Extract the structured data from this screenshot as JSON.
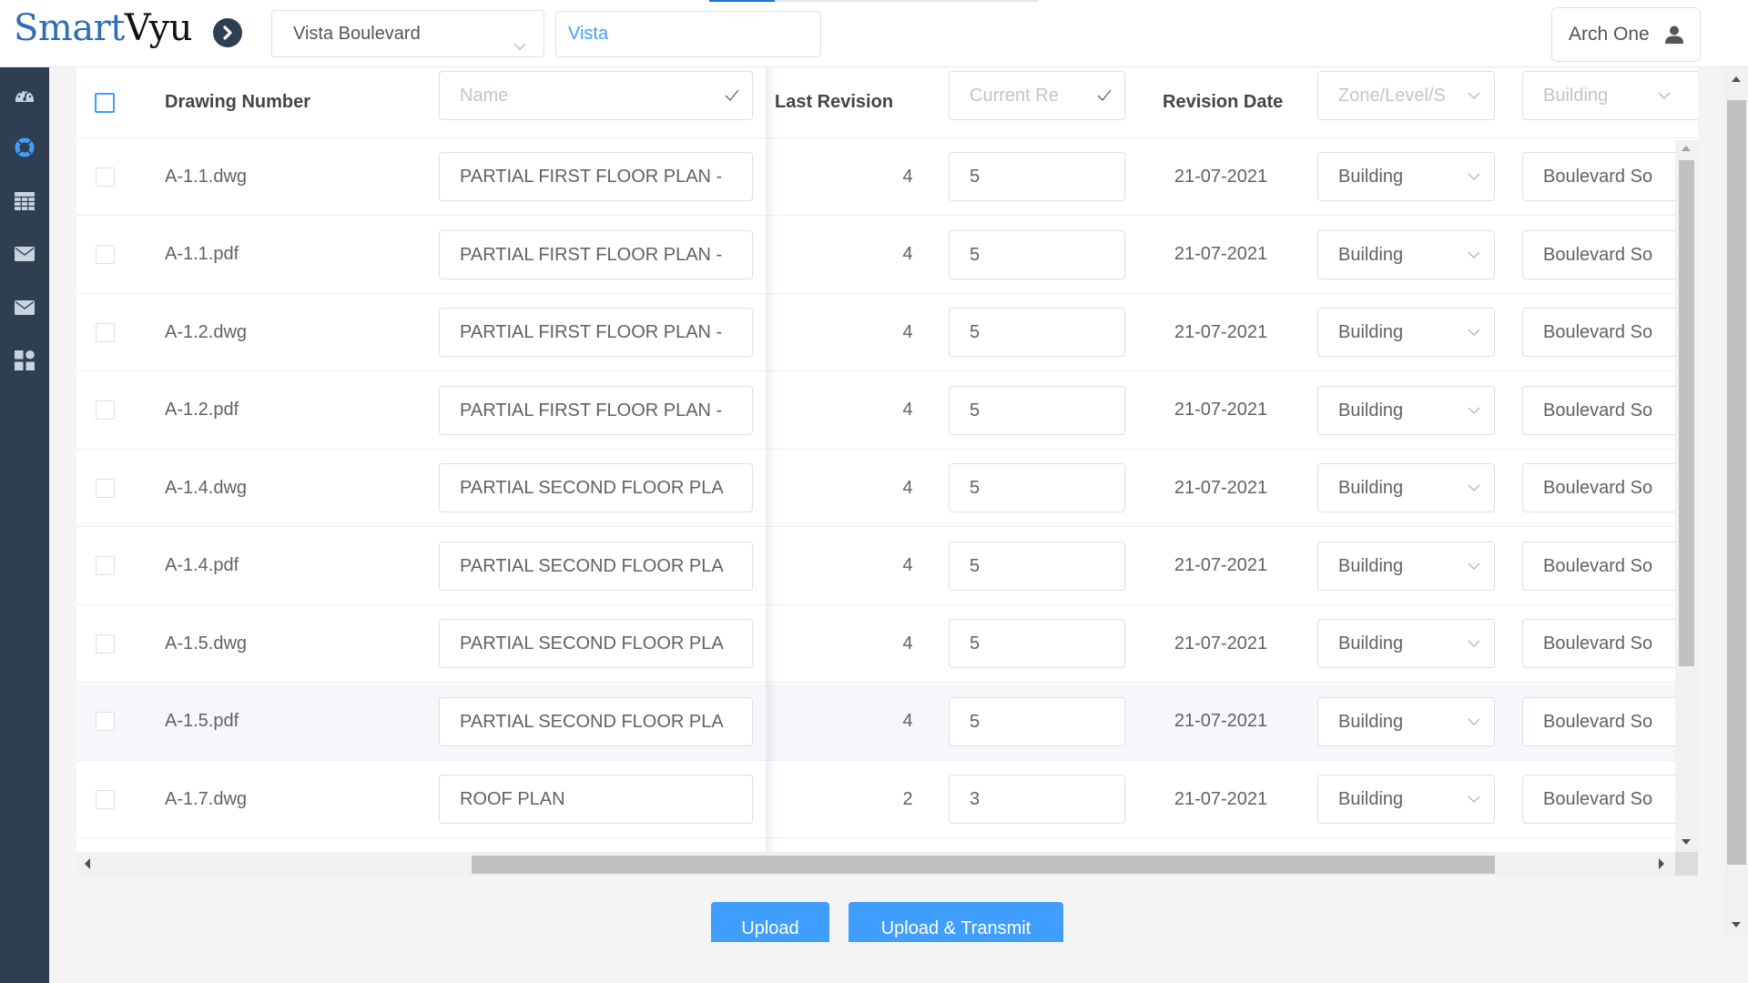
{
  "header": {
    "logo_part1": "Smart",
    "logo_part2": "Vyu",
    "project_select": "Vista Boulevard",
    "search_value": "Vista",
    "user_name": "Arch One",
    "progress": 0.2
  },
  "sidebar": {
    "items": [
      {
        "name": "dashboard",
        "active": false
      },
      {
        "name": "support",
        "active": true
      },
      {
        "name": "table",
        "active": false
      },
      {
        "name": "mail",
        "active": false
      },
      {
        "name": "mail-2",
        "active": false
      },
      {
        "name": "apps",
        "active": false
      }
    ]
  },
  "colors": {
    "accent": "#409eff",
    "sidebar_bg": "#2f3e51",
    "logo_blue": "#2f6db5"
  },
  "table": {
    "headers": {
      "drawing_number": "Drawing Number",
      "name_placeholder": "Name",
      "last_revision": "Last Revision",
      "current_rev_placeholder": "Current Re",
      "revision_date": "Revision Date",
      "zone_placeholder": "Zone/Level/S",
      "building_placeholder": "Building"
    },
    "rows": [
      {
        "drawing_number": "A-1.1.dwg",
        "name": "PARTIAL FIRST FLOOR PLAN -",
        "last_revision": "4",
        "current_revision": "5",
        "revision_date": "21-07-2021",
        "zone": "Building",
        "building": "Boulevard So"
      },
      {
        "drawing_number": "A-1.1.pdf",
        "name": "PARTIAL FIRST FLOOR PLAN -",
        "last_revision": "4",
        "current_revision": "5",
        "revision_date": "21-07-2021",
        "zone": "Building",
        "building": "Boulevard So"
      },
      {
        "drawing_number": "A-1.2.dwg",
        "name": "PARTIAL FIRST FLOOR PLAN -",
        "last_revision": "4",
        "current_revision": "5",
        "revision_date": "21-07-2021",
        "zone": "Building",
        "building": "Boulevard So"
      },
      {
        "drawing_number": "A-1.2.pdf",
        "name": "PARTIAL FIRST FLOOR PLAN -",
        "last_revision": "4",
        "current_revision": "5",
        "revision_date": "21-07-2021",
        "zone": "Building",
        "building": "Boulevard So"
      },
      {
        "drawing_number": "A-1.4.dwg",
        "name": "PARTIAL SECOND FLOOR PLA",
        "last_revision": "4",
        "current_revision": "5",
        "revision_date": "21-07-2021",
        "zone": "Building",
        "building": "Boulevard So"
      },
      {
        "drawing_number": "A-1.4.pdf",
        "name": "PARTIAL SECOND FLOOR PLA",
        "last_revision": "4",
        "current_revision": "5",
        "revision_date": "21-07-2021",
        "zone": "Building",
        "building": "Boulevard So"
      },
      {
        "drawing_number": "A-1.5.dwg",
        "name": "PARTIAL SECOND FLOOR PLA",
        "last_revision": "4",
        "current_revision": "5",
        "revision_date": "21-07-2021",
        "zone": "Building",
        "building": "Boulevard So"
      },
      {
        "drawing_number": "A-1.5.pdf",
        "name": "PARTIAL SECOND FLOOR PLA",
        "last_revision": "4",
        "current_revision": "5",
        "revision_date": "21-07-2021",
        "zone": "Building",
        "building": "Boulevard So",
        "hovered": true
      },
      {
        "drawing_number": "A-1.7.dwg",
        "name": "ROOF PLAN",
        "last_revision": "2",
        "current_revision": "3",
        "revision_date": "21-07-2021",
        "zone": "Building",
        "building": "Boulevard So"
      }
    ]
  },
  "actions": {
    "upload_label": "Upload",
    "upload_transmit_label": "Upload & Transmit"
  }
}
